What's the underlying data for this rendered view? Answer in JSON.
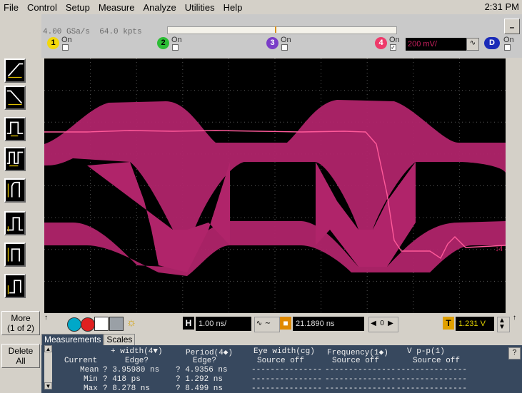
{
  "menu": {
    "items": [
      "File",
      "Control",
      "Setup",
      "Measure",
      "Analyze",
      "Utilities",
      "Help"
    ],
    "clock": "2:31 PM"
  },
  "acquisition": {
    "sample_rate": "4.00 GSa/s",
    "memory": "64.0 kpts"
  },
  "channels": [
    {
      "num": "1",
      "state": "On",
      "color": "#f2d80c",
      "checked": false
    },
    {
      "num": "2",
      "state": "On",
      "color": "#2cbd35",
      "checked": false
    },
    {
      "num": "3",
      "state": "On",
      "color": "#7a3cc8",
      "checked": false
    },
    {
      "num": "4",
      "state": "On",
      "color": "#ee3a6a",
      "checked": true,
      "scale": "200 mV/"
    }
  ],
  "digital": {
    "label": "D",
    "state": "On"
  },
  "sidebar": {
    "tools": [
      "rise-time-icon",
      "fall-time-icon",
      "positive-width-icon",
      "period-icon",
      "pulse-rise-icon",
      "pulse-base-icon",
      "pulse-top-icon",
      "pulse-fall-icon"
    ],
    "more_label": "More",
    "more_sub": "(1 of 2)",
    "delete_label": "Delete",
    "delete_sub": "All"
  },
  "timebase": {
    "h_icon": "H",
    "scale": "1.00 ns/",
    "position": "21.1890 ns",
    "zero": "0",
    "trigger_icon": "T",
    "trigger_level": "1.231 V"
  },
  "measurements": {
    "tabs": [
      "Measurements",
      "Scales"
    ],
    "headers": [
      "+ width(4▼)",
      "Period(4◆)",
      "Eye width(cg)",
      "Frequency(1◆)",
      "V p-p(1)"
    ],
    "sub_headers": [
      "Edge?",
      "Edge?",
      "Source off",
      "Source off",
      "Source off"
    ],
    "row_labels": [
      "Current",
      "Mean",
      "Min",
      "Max"
    ],
    "rows": [
      [
        "",
        "",
        "",
        "",
        ""
      ],
      [
        "? 3.95980 ns",
        "? 4.9356 ns",
        "---------------",
        "---------------",
        "---------------"
      ],
      [
        "? 418 ps",
        "? 1.292 ns",
        "---------------",
        "---------------",
        "---------------"
      ],
      [
        "? 8.278 ns",
        "? 8.499 ns",
        "---------------",
        "---------------",
        "---------------"
      ]
    ]
  },
  "colors": {
    "trace": "#b0246a",
    "trace_line": "#ff5a9a",
    "grid": "#555555"
  }
}
